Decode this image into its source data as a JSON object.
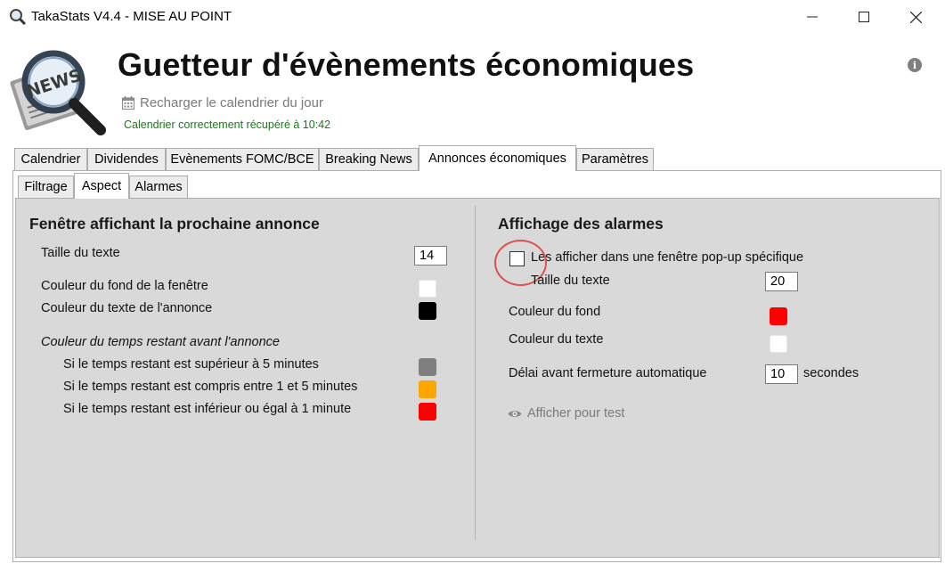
{
  "window": {
    "title": "TakaStats V4.4 - MISE AU POINT",
    "minimize": "—",
    "maximize": "☐",
    "close": "✕"
  },
  "header": {
    "logo_text": "NEWS",
    "title": "Guetteur d'évènements économiques",
    "reload_label": "Recharger le calendrier du jour",
    "status": "Calendrier correctement récupéré à 10:42",
    "info_glyph": "i"
  },
  "main_tabs": [
    {
      "label": "Calendrier"
    },
    {
      "label": "Dividendes"
    },
    {
      "label": "Evènements FOMC/BCE"
    },
    {
      "label": "Breaking News"
    },
    {
      "label": "Annonces économiques"
    },
    {
      "label": "Paramètres"
    }
  ],
  "sub_tabs": [
    {
      "label": "Filtrage"
    },
    {
      "label": "Aspect"
    },
    {
      "label": "Alarmes"
    }
  ],
  "left_section": {
    "title": "Fenêtre affichant la prochaine annonce",
    "text_size_label": "Taille du texte",
    "text_size_value": "14",
    "bg_color_label": "Couleur du fond de la fenêtre",
    "bg_color": "#ffffff",
    "text_color_label": "Couleur du texte de l'annonce",
    "text_color": "#000000",
    "remaining_heading": "Couleur du temps restant avant l'annonce",
    "remaining_rows": [
      {
        "label": "Si le temps restant est supérieur à 5 minutes",
        "color": "#7f7f7f"
      },
      {
        "label": "Si le temps restant est compris entre 1 et 5 minutes",
        "color": "#ffa500"
      },
      {
        "label": "Si le temps restant est inférieur ou égal à 1 minute",
        "color": "#ff0000"
      }
    ]
  },
  "right_section": {
    "title": "Affichage des alarmes",
    "popup_label": "Les afficher dans une fenêtre pop-up spécifique",
    "popup_checked": false,
    "text_size_label": "Taille du texte",
    "text_size_value": "20",
    "bg_color_label": "Couleur du fond",
    "bg_color": "#ff0000",
    "text_color_label": "Couleur du texte",
    "text_color": "#ffffff",
    "delay_label": "Délai avant fermeture automatique",
    "delay_value": "10",
    "delay_unit": "secondes",
    "test_label": "Afficher pour test"
  }
}
